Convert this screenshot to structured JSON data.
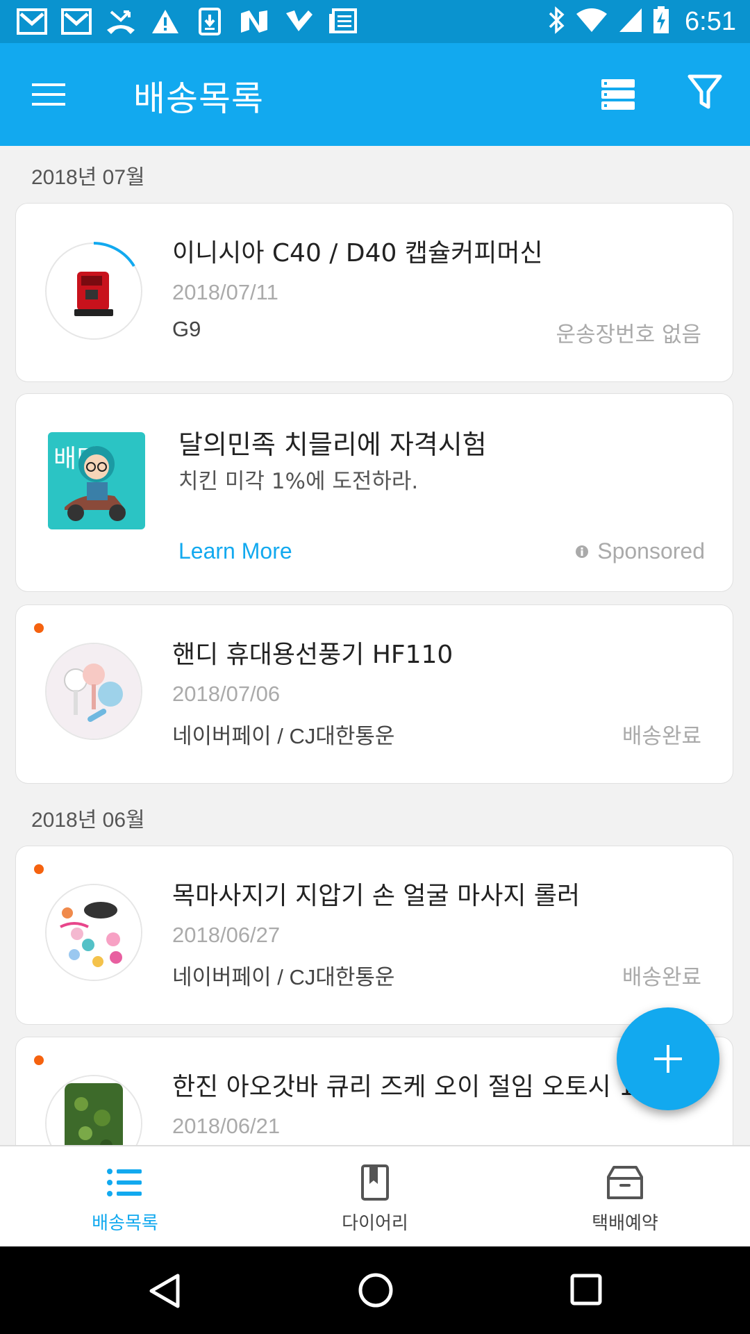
{
  "status_bar": {
    "time": "6:51",
    "left_icons": [
      "gmail-icon",
      "gmail-icon",
      "missed-call-icon",
      "warning-icon",
      "download-icon",
      "n-app-icon",
      "check-app-icon",
      "news-icon"
    ],
    "right_icons": [
      "bluetooth-icon",
      "wifi-icon",
      "signal-icon",
      "battery-charging-icon"
    ]
  },
  "appbar": {
    "title": "배송목록"
  },
  "sections": [
    {
      "header": "2018년 07월"
    },
    {
      "header": "2018년 06월"
    }
  ],
  "items": [
    {
      "title": "이니시아 C40 / D40 캡슐커피머신",
      "date": "2018/07/11",
      "source": "G9",
      "status": "운송장번호 없음",
      "unread": false
    },
    {
      "title": "핸디 휴대용선풍기 HF110",
      "date": "2018/07/06",
      "source": "네이버페이 / CJ대한통운",
      "status": "배송완료",
      "unread": true
    },
    {
      "title": "목마사지기 지압기 손 얼굴 마사지 롤러",
      "date": "2018/06/27",
      "source": "네이버페이 / CJ대한통운",
      "status": "배송완료",
      "unread": true
    },
    {
      "title": "한진 아오갓바 큐리 즈케 오이 절임 오토시 1",
      "date": "2018/06/21",
      "unread": true
    }
  ],
  "ad": {
    "title": "달의민족 치믈리에 자격시험",
    "subtitle": "치킨 미각 1%에 도전하라.",
    "cta": "Learn More",
    "sponsored": "Sponsored",
    "logo_text": "배민"
  },
  "bottom_nav": [
    {
      "label": "배송목록",
      "icon": "list-icon",
      "active": true
    },
    {
      "label": "다이어리",
      "icon": "bookmark-book-icon",
      "active": false
    },
    {
      "label": "택배예약",
      "icon": "box-icon",
      "active": false
    }
  ],
  "colors": {
    "accent": "#12a9ef",
    "status_bar": "#0a93cf",
    "unread_dot": "#f5620f"
  }
}
